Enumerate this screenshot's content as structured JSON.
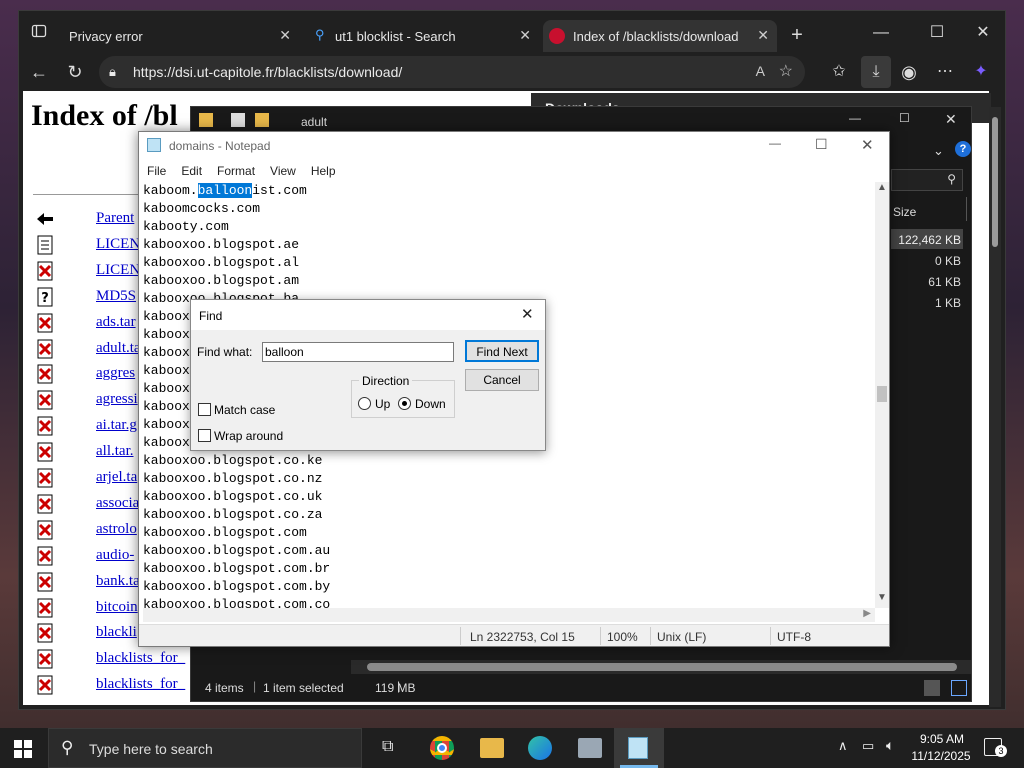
{
  "browser": {
    "tabs": [
      {
        "title": "Privacy error"
      },
      {
        "title": "ut1 blocklist - Search"
      },
      {
        "title": "Index of /blacklists/download"
      }
    ],
    "address": "https://dsi.ut-capitole.fr/blacklists/download/",
    "downloads_label": "Downloads"
  },
  "page": {
    "heading": "Index of /bl",
    "rows": [
      {
        "text": "Parent",
        "icon": "back-icon"
      },
      {
        "text": "LICEN",
        "icon": "text-file-icon"
      },
      {
        "text": "LICEN",
        "icon": "binary-file-icon"
      },
      {
        "text": "MD5S",
        "icon": "unknown-file-icon"
      },
      {
        "text": "ads.tar",
        "icon": "binary-file-icon"
      },
      {
        "text": "adult.ta",
        "icon": "binary-file-icon"
      },
      {
        "text": "aggres",
        "icon": "binary-file-icon"
      },
      {
        "text": "agressi",
        "icon": "binary-file-icon"
      },
      {
        "text": "ai.tar.g",
        "icon": "binary-file-icon"
      },
      {
        "text": "all.tar.",
        "icon": "binary-file-icon"
      },
      {
        "text": "arjel.ta",
        "icon": "binary-file-icon"
      },
      {
        "text": "associa",
        "icon": "binary-file-icon"
      },
      {
        "text": "astrolo",
        "icon": "binary-file-icon"
      },
      {
        "text": "audio-",
        "icon": "binary-file-icon"
      },
      {
        "text": "bank.ta",
        "icon": "binary-file-icon"
      },
      {
        "text": "bitcoin",
        "icon": "binary-file-icon"
      },
      {
        "text": "blackli",
        "icon": "binary-file-icon"
      },
      {
        "text": "blacklists_for_",
        "icon": "binary-file-icon"
      },
      {
        "text": "blacklists_for_",
        "icon": "binary-file-icon"
      }
    ]
  },
  "explorer": {
    "path": "adult",
    "column_size": "Size",
    "sizes": [
      "122,462 KB",
      "0 KB",
      "61 KB",
      "1 KB"
    ],
    "status": {
      "items": "4 items",
      "selected": "1 item selected",
      "size": "119 MB"
    }
  },
  "notepad": {
    "title": "domains - Notepad",
    "menu": [
      "File",
      "Edit",
      "Format",
      "View",
      "Help"
    ],
    "first_line": {
      "before": "kaboom.",
      "match": "balloon",
      "after": "ist.com"
    },
    "lines": [
      "kaboomcocks.com",
      "kabooty.com",
      "kabooxoo.blogspot.ae",
      "kabooxoo.blogspot.al",
      "kabooxoo.blogspot.am",
      "kabooxoo.blogspot.ba",
      "kaboox",
      "kaboox",
      "kaboox",
      "kaboox",
      "kaboox",
      "kaboox",
      "kaboox",
      "kaboox",
      "kabooxoo.blogspot.co.ke",
      "kabooxoo.blogspot.co.nz",
      "kabooxoo.blogspot.co.uk",
      "kabooxoo.blogspot.co.za",
      "kabooxoo.blogspot.com",
      "kabooxoo.blogspot.com.au",
      "kabooxoo.blogspot.com.br",
      "kabooxoo.blogspot.com.by",
      "kabooxoo.blogspot.com.co"
    ],
    "status": {
      "position": "Ln 2322753, Col 15",
      "zoom": "100%",
      "eol": "Unix (LF)",
      "encoding": "UTF-8"
    }
  },
  "find_dialog": {
    "title": "Find",
    "find_what_label": "Find what:",
    "find_what_value": "balloon",
    "find_next_label": "Find Next",
    "cancel_label": "Cancel",
    "direction_label": "Direction",
    "up_label": "Up",
    "down_label": "Down",
    "direction_selected": "Down",
    "match_case_label": "Match case",
    "match_case_checked": false,
    "wrap_around_label": "Wrap around",
    "wrap_around_checked": false
  },
  "taskbar": {
    "search_placeholder": "Type here to search",
    "time": "9:05 AM",
    "date": "11/12/2025",
    "notifications": "3"
  },
  "colors": {
    "selection": "#0078d7",
    "link": "#0000cc",
    "icon_red": "#cc0000"
  }
}
